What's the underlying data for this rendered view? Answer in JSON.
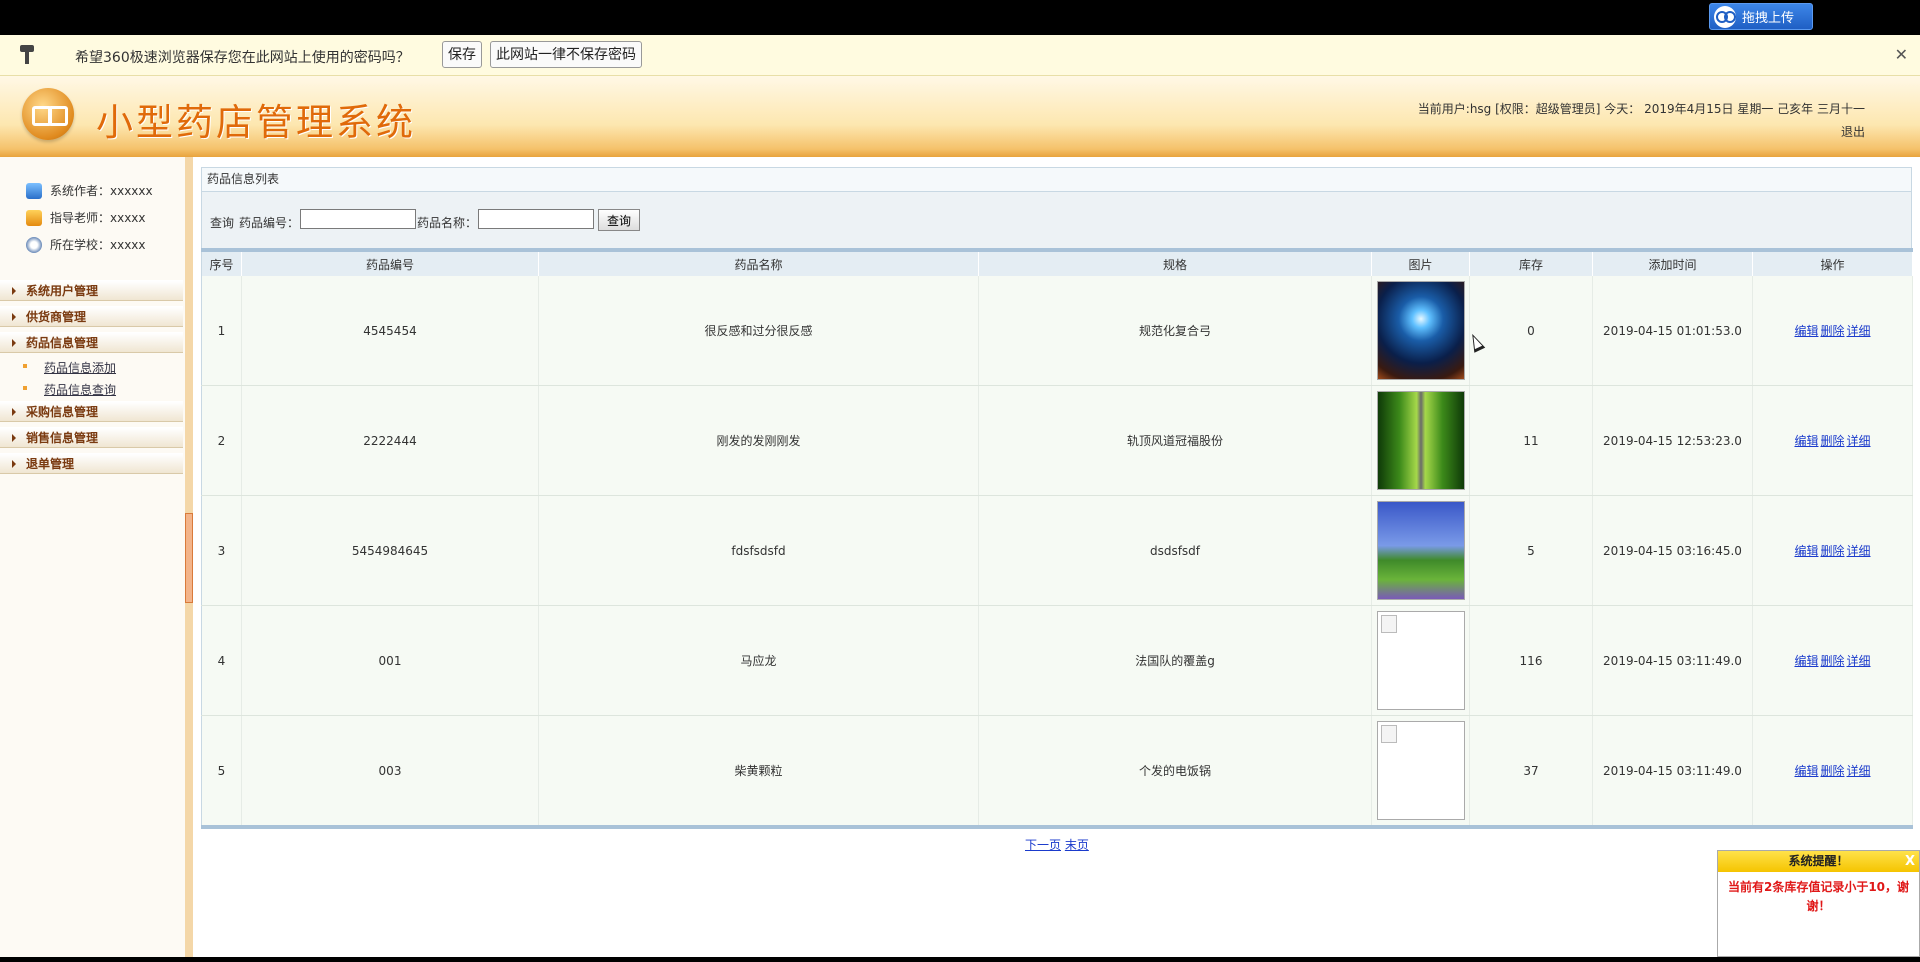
{
  "topbar": {
    "upload_label": "拖拽上传"
  },
  "password_bar": {
    "message": "希望360极速浏览器保存您在此网站上使用的密码吗？",
    "save_label": "保存",
    "never_label": "此网站一律不保存密码",
    "close_label": "✕"
  },
  "header": {
    "title": "小型药店管理系统",
    "user_info": "当前用户:hsg [权限：超级管理员] 今天： 2019年4月15日 星期一 己亥年 三月十一",
    "logout_label": "退出"
  },
  "sidebar": {
    "info": [
      {
        "label": "系统作者：xxxxxx",
        "icon": "user-icon"
      },
      {
        "label": "指导老师：xxxxx",
        "icon": "teacher-icon"
      },
      {
        "label": "所在学校：xxxxx",
        "icon": "school-icon"
      }
    ],
    "menus": [
      "系统用户管理",
      "供货商管理",
      "药品信息管理",
      "采购信息管理",
      "销售信息管理",
      "退单管理"
    ],
    "submenus": [
      "药品信息添加",
      "药品信息查询"
    ]
  },
  "panel": {
    "title": "药品信息列表"
  },
  "search": {
    "prefix": "查询",
    "code_label": "药品编号：",
    "name_label": "药品名称：",
    "code_value": "",
    "name_value": "",
    "button_label": "查询"
  },
  "table": {
    "headers": [
      "序号",
      "药品编号",
      "药品名称",
      "规格",
      "图片",
      "库存",
      "添加时间",
      "操作"
    ],
    "rows": [
      {
        "index": "1",
        "code": "4545454",
        "name": "很反感和过分很反感",
        "spec": "规范化复合弓",
        "image": "blue-light-scene",
        "stock": "0",
        "time": "2019-04-15 01:01:53.0"
      },
      {
        "index": "2",
        "code": "2222444",
        "name": "刚发的发刚刚发",
        "spec": "轨顶风道冠福股份",
        "image": "forest-road-scene",
        "stock": "11",
        "time": "2019-04-15 12:53:23.0"
      },
      {
        "index": "3",
        "code": "5454984645",
        "name": "fdsfsdsfd",
        "spec": "dsdsfsdf",
        "image": "trees-meadow-scene",
        "stock": "5",
        "time": "2019-04-15 03:16:45.0"
      },
      {
        "index": "4",
        "code": "001",
        "name": "马应龙",
        "spec": "法国队的覆盖g",
        "image": "broken-image",
        "stock": "116",
        "time": "2019-04-15 03:11:49.0"
      },
      {
        "index": "5",
        "code": "003",
        "name": "柴黄颗粒",
        "spec": "个发的电饭锅",
        "image": "broken-image",
        "stock": "37",
        "time": "2019-04-15 03:11:49.0"
      }
    ],
    "ops": {
      "edit": "编辑",
      "delete": "删除",
      "detail": "详细"
    }
  },
  "pager": {
    "next": "下一页",
    "last": "末页"
  },
  "alert": {
    "title": "系统提醒！",
    "close": "X",
    "message": "当前有2条库存值记录小于10，谢谢！"
  },
  "colors": {
    "title_orange": "#e06a0a",
    "menu_text": "#7a3a10",
    "link_blue": "#1a3acc",
    "alert_red": "#e01818",
    "alert_yellow": "#f5c400"
  }
}
